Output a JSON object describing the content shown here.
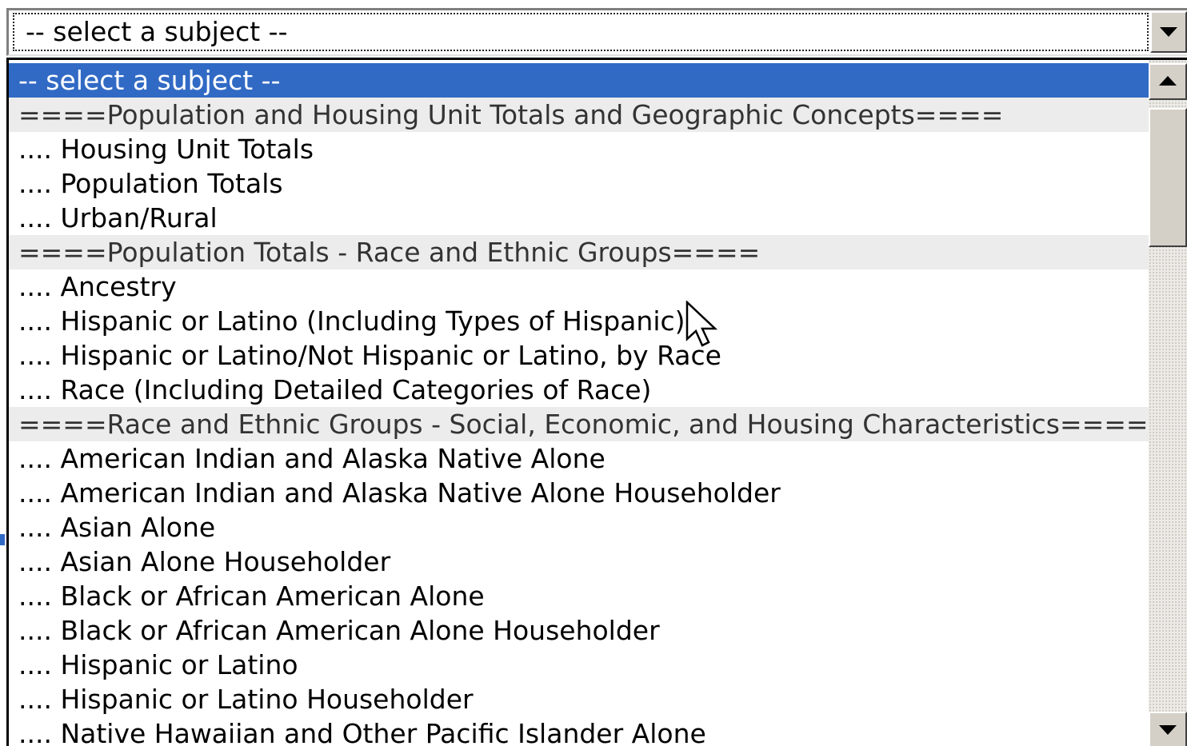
{
  "select": {
    "current_value": "-- select a subject --"
  },
  "options": [
    {
      "label": "-- select a subject --",
      "kind": "selected"
    },
    {
      "label": "====Population and Housing Unit Totals and Geographic Concepts====",
      "kind": "group"
    },
    {
      "label": ".... Housing Unit Totals",
      "kind": "item"
    },
    {
      "label": ".... Population Totals",
      "kind": "item"
    },
    {
      "label": ".... Urban/Rural",
      "kind": "item"
    },
    {
      "label": "====Population Totals - Race and Ethnic Groups====",
      "kind": "group"
    },
    {
      "label": ".... Ancestry",
      "kind": "item"
    },
    {
      "label": ".... Hispanic or Latino (Including Types of Hispanic)",
      "kind": "item"
    },
    {
      "label": ".... Hispanic or Latino/Not Hispanic or Latino, by Race",
      "kind": "item"
    },
    {
      "label": ".... Race (Including Detailed Categories of Race)",
      "kind": "item"
    },
    {
      "label": "====Race and Ethnic Groups - Social, Economic, and Housing Characteristics====",
      "kind": "group"
    },
    {
      "label": ".... American Indian and Alaska Native Alone",
      "kind": "item"
    },
    {
      "label": ".... American Indian and Alaska Native Alone Householder",
      "kind": "item"
    },
    {
      "label": ".... Asian Alone",
      "kind": "item"
    },
    {
      "label": ".... Asian Alone Householder",
      "kind": "item"
    },
    {
      "label": ".... Black or African American Alone",
      "kind": "item"
    },
    {
      "label": ".... Black or African American Alone Householder",
      "kind": "item"
    },
    {
      "label": ".... Hispanic or Latino",
      "kind": "item"
    },
    {
      "label": ".... Hispanic or Latino Householder",
      "kind": "item"
    },
    {
      "label": ".... Native Hawaiian and Other Pacific Islander Alone",
      "kind": "item"
    }
  ],
  "icons": {
    "dropdown_arrow": "chevron-down-icon",
    "scroll_up": "scroll-up-icon",
    "scroll_down": "scroll-down-icon",
    "cursor": "mouse-pointer-icon"
  },
  "colors": {
    "selection_bg": "#316ac5",
    "selection_text": "#ffffff",
    "group_bg": "#ececec",
    "button_face": "#d4d0c8"
  }
}
